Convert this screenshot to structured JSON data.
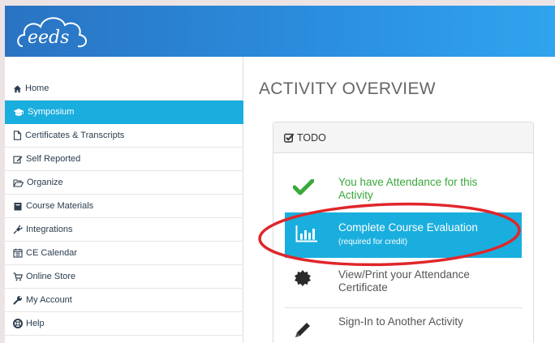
{
  "header": {
    "logo_text": "eeds"
  },
  "sidebar": {
    "items": [
      {
        "label": "Home",
        "icon": "home-icon",
        "active": false
      },
      {
        "label": "Symposium",
        "icon": "graduation-cap-icon",
        "active": true
      },
      {
        "label": "Certificates & Transcripts",
        "icon": "file-icon",
        "active": false
      },
      {
        "label": "Self Reported",
        "icon": "edit-icon",
        "active": false
      },
      {
        "label": "Organize",
        "icon": "folder-open-icon",
        "active": false
      },
      {
        "label": "Course Materials",
        "icon": "book-icon",
        "active": false
      },
      {
        "label": "Integrations",
        "icon": "plug-icon",
        "active": false
      },
      {
        "label": "CE Calendar",
        "icon": "calendar-icon",
        "active": false
      },
      {
        "label": "Online Store",
        "icon": "shopping-cart-icon",
        "active": false
      },
      {
        "label": "My Account",
        "icon": "wrench-icon",
        "active": false
      },
      {
        "label": "Help",
        "icon": "life-ring-icon",
        "active": false
      }
    ]
  },
  "main": {
    "title": "ACTIVITY OVERVIEW",
    "todo": {
      "heading": "TODO",
      "items": [
        {
          "text": "You have Attendance for this Activity",
          "icon": "checkmark-icon",
          "status_color": "#3aa83a"
        },
        {
          "text": "Complete Course Evaluation",
          "sub": "(required for credit)",
          "icon": "bar-chart-icon",
          "highlight": true
        },
        {
          "text": "View/Print your Attendance Certificate",
          "icon": "certificate-icon"
        },
        {
          "text": "Sign-In to Another Activity",
          "icon": "pencil-icon"
        }
      ]
    }
  },
  "colors": {
    "accent": "#1aaede",
    "header": "#2b8fe0",
    "success": "#3aa83a",
    "annotation": "#e0262a"
  }
}
